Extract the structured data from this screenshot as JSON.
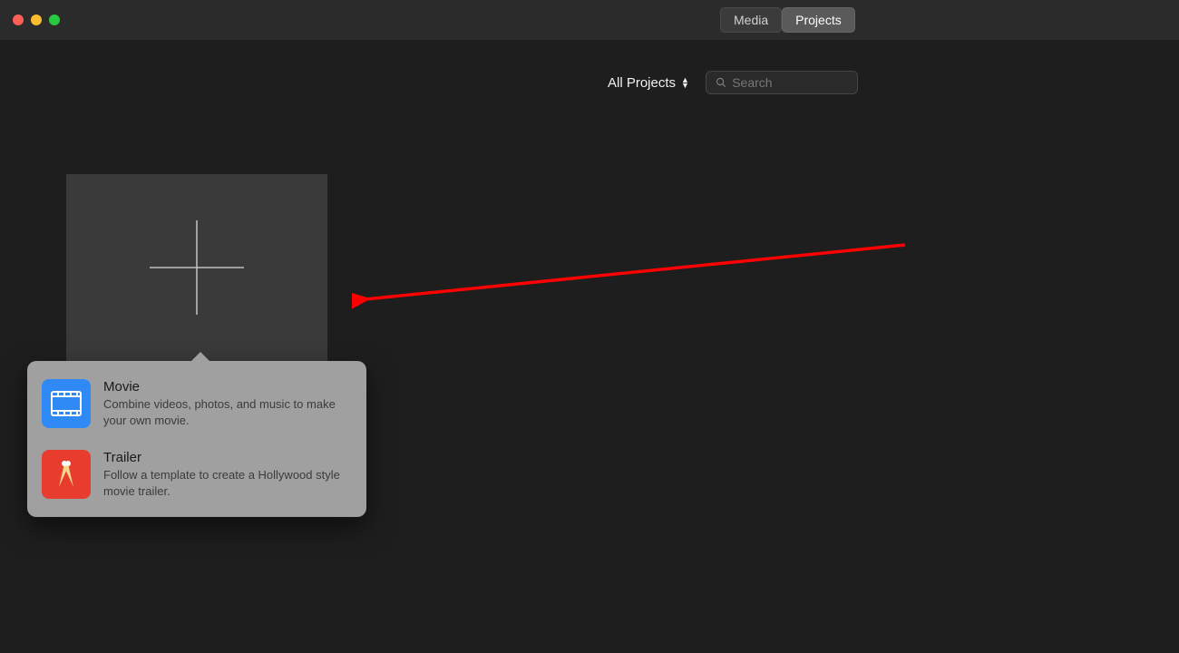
{
  "titlebar": {
    "tabs": [
      {
        "label": "Media",
        "active": false
      },
      {
        "label": "Projects",
        "active": true
      }
    ]
  },
  "toolbar": {
    "filter_label": "All Projects",
    "search_placeholder": "Search"
  },
  "popover": {
    "items": [
      {
        "key": "movie",
        "title": "Movie",
        "desc": "Combine videos, photos, and music to make your own movie."
      },
      {
        "key": "trailer",
        "title": "Trailer",
        "desc": "Follow a template to create a Hollywood style movie trailer."
      }
    ]
  },
  "colors": {
    "movie_icon_bg": "#2f8af5",
    "trailer_icon_bg": "#e73c2e",
    "annotation_arrow": "#ff0000"
  }
}
